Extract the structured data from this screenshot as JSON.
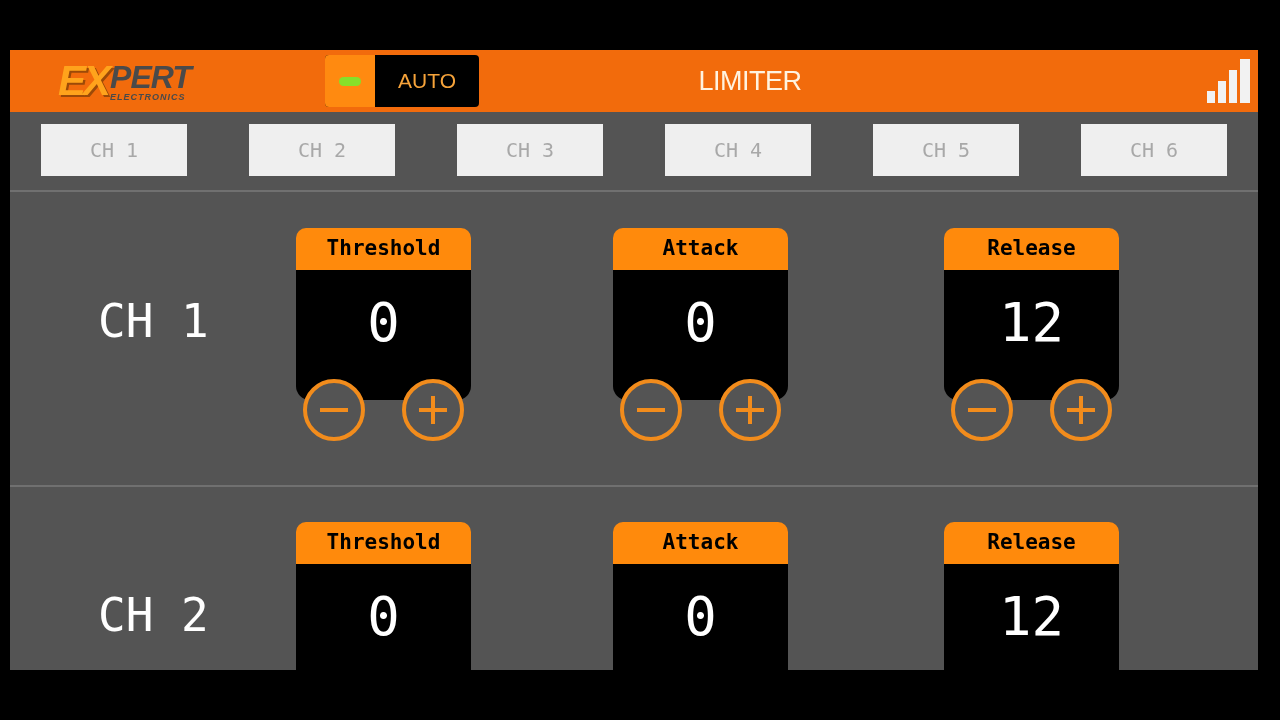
{
  "header": {
    "logo": {
      "mark": "EX",
      "name": "PERT",
      "tagline": "ELECTRONICS"
    },
    "auto_toggle": {
      "label": "AUTO",
      "on": true
    },
    "title": "LIMITER"
  },
  "channel_tabs": [
    {
      "label": "CH 1"
    },
    {
      "label": "CH 2"
    },
    {
      "label": "CH 3"
    },
    {
      "label": "CH 4"
    },
    {
      "label": "CH 5"
    },
    {
      "label": "CH 6"
    }
  ],
  "channels": [
    {
      "name": "CH 1",
      "clipped": false,
      "parameters": [
        {
          "label": "Threshold",
          "value": "0"
        },
        {
          "label": "Attack",
          "value": "0"
        },
        {
          "label": "Release",
          "value": "12"
        }
      ]
    },
    {
      "name": "CH 2",
      "clipped": true,
      "parameters": [
        {
          "label": "Threshold",
          "value": "0"
        },
        {
          "label": "Attack",
          "value": "0"
        },
        {
          "label": "Release",
          "value": "12"
        }
      ]
    }
  ]
}
